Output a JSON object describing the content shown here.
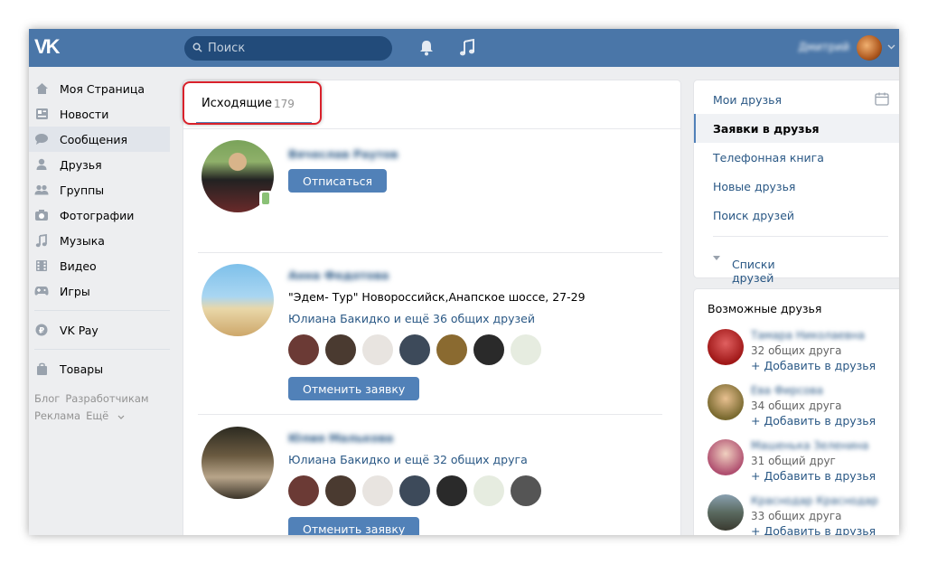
{
  "header": {
    "logo": "VK",
    "search_placeholder": "Поиск",
    "user_name": "Дмитрий"
  },
  "leftnav": {
    "items": [
      {
        "label": "Моя Страница",
        "icon": "home-icon"
      },
      {
        "label": "Новости",
        "icon": "news-icon"
      },
      {
        "label": "Сообщения",
        "icon": "messages-icon"
      },
      {
        "label": "Друзья",
        "icon": "friend-icon"
      },
      {
        "label": "Группы",
        "icon": "groups-icon"
      },
      {
        "label": "Фотографии",
        "icon": "camera-icon"
      },
      {
        "label": "Музыка",
        "icon": "music-icon"
      },
      {
        "label": "Видео",
        "icon": "video-icon"
      },
      {
        "label": "Игры",
        "icon": "gamepad-icon"
      },
      {
        "label": "VK Pay",
        "icon": "vkpay-icon"
      },
      {
        "label": "Товары",
        "icon": "bag-icon"
      }
    ],
    "footer": [
      "Блог",
      "Разработчикам",
      "Реклама",
      "Ещё"
    ]
  },
  "main": {
    "tab": {
      "label": "Исходящие",
      "count": "179"
    },
    "requests": [
      {
        "name": "Вячеслав Раутов",
        "button": "Отписаться"
      },
      {
        "name": "Анна Федотова",
        "info": "\"Эдем- Тур\" Новороссийск,Анапское шоссе, 27-29",
        "mutual": "Юлиана Бакидко и ещё 36 общих друзей",
        "button": "Отменить заявку"
      },
      {
        "name": "Юлия Малькова",
        "mutual": "Юлиана Бакидко и ещё 32 общих друга",
        "button": "Отменить заявку"
      }
    ]
  },
  "rightnav": {
    "items": [
      "Мои друзья",
      "Заявки в друзья",
      "Телефонная книга",
      "Новые друзья",
      "Поиск друзей"
    ],
    "lists": "Списки друзей"
  },
  "suggestions": {
    "title": "Возможные друзья",
    "add_label": "+ Добавить в друзья",
    "people": [
      {
        "name": "Тамара Николаевна",
        "mutual": "32 общих друга"
      },
      {
        "name": "Ева Фирсова",
        "mutual": "34 общих друга"
      },
      {
        "name": "Машенька Зеленина",
        "mutual": "31 общий друг"
      },
      {
        "name": "Краснодар Краснодар",
        "mutual": "33 общих друга"
      }
    ]
  },
  "colors": {
    "brand": "#4a76a8",
    "button": "#5181b8",
    "link": "#2a5885",
    "highlight": "#d9212b"
  }
}
